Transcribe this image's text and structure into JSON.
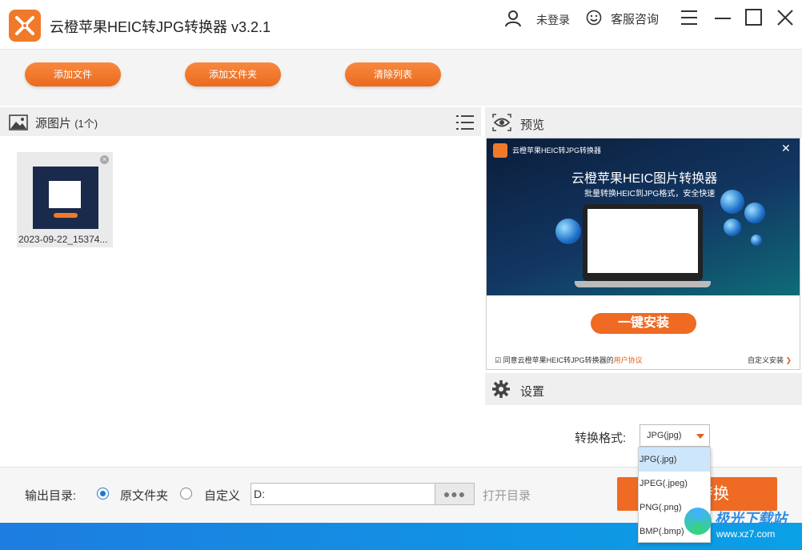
{
  "app": {
    "title": "云橙苹果HEIC转JPG转换器 v3.2.1"
  },
  "header": {
    "login": "未登录",
    "service": "客服咨询"
  },
  "toolbar": {
    "add_file": "添加文件",
    "add_folder": "添加文件夹",
    "clear_list": "清除列表"
  },
  "source": {
    "title": "源图片",
    "count": "(1个)",
    "files": [
      {
        "name": "2023-09-22_15374..."
      }
    ]
  },
  "preview": {
    "title": "预览",
    "app_name": "云橙苹果HEIC转JPG转换器",
    "headline": "云橙苹果HEIC图片转换器",
    "subline": "批量转换HEIC到JPG格式，安全快速",
    "install": "一键安装",
    "agree": "同意云橙苹果HEIC转JPG转换器的",
    "agree_link": "用户协议",
    "custom_install": "自定义安装"
  },
  "settings": {
    "title": "设置",
    "format_label": "转换格式:",
    "format_selected": "JPG(jpg)",
    "options": [
      "JPG(.jpg)",
      "JPEG(.jpeg)",
      "PNG(.png)",
      "BMP(.bmp)"
    ]
  },
  "output": {
    "label": "输出目录:",
    "original": "原文件夹",
    "custom": "自定义",
    "path": "D:",
    "browse": "●●●",
    "open_dir": "打开目录",
    "convert": "转换"
  },
  "watermark": {
    "brand": "极光下载站",
    "url": "www.xz7.com"
  },
  "colors": {
    "accent": "#ef6a22",
    "radio": "#1e78d2"
  }
}
